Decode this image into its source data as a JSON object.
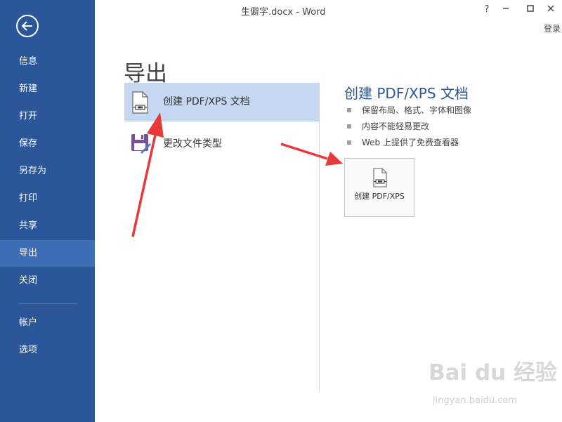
{
  "window": {
    "title": "生僻字.docx - Word",
    "help": "?",
    "login": "登录"
  },
  "sidebar": {
    "items": [
      {
        "label": "信息"
      },
      {
        "label": "新建"
      },
      {
        "label": "打开"
      },
      {
        "label": "保存"
      },
      {
        "label": "另存为"
      },
      {
        "label": "打印"
      },
      {
        "label": "共享"
      },
      {
        "label": "导出"
      },
      {
        "label": "关闭"
      },
      {
        "label": "帐户"
      },
      {
        "label": "选项"
      }
    ],
    "active": "导出"
  },
  "main": {
    "title": "导出",
    "options": [
      {
        "label": "创建 PDF/XPS 文档",
        "icon": "pdf-document-icon"
      },
      {
        "label": "更改文件类型",
        "icon": "change-file-type-icon"
      }
    ]
  },
  "panel": {
    "title": "创建 PDF/XPS 文档",
    "bullets": [
      "保留布局、格式、字体和图像",
      "内容不能轻易更改",
      "Web 上提供了免费查看器"
    ],
    "button_label": "创建 PDF/XPS"
  },
  "watermark": {
    "brand": "Bai du 经验",
    "url": "jingyan.baidu.com"
  },
  "colors": {
    "sidebar": "#2b579a",
    "accent": "#2b579a",
    "selected": "#c5d7f1",
    "arrow": "#e8393a"
  }
}
